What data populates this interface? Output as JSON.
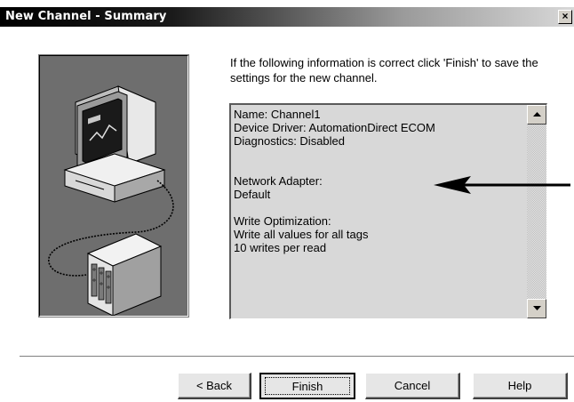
{
  "window": {
    "title": "New Channel - Summary",
    "close_glyph": "×"
  },
  "intro_text": "If the following information is correct click 'Finish' to save the settings for the new channel.",
  "summary": {
    "lines": [
      "Name: Channel1",
      "Device Driver: AutomationDirect ECOM",
      "Diagnostics: Disabled",
      "",
      "",
      "Network Adapter:",
      "Default",
      "",
      "Write Optimization:",
      "Write all values for all tags",
      "10 writes per read"
    ]
  },
  "buttons": {
    "back": "< Back",
    "finish": "Finish",
    "cancel": "Cancel",
    "help": "Help"
  },
  "icons": {
    "illustration": "computer-network-device-illustration",
    "scroll_up": "scroll-up-arrow-icon",
    "scroll_down": "scroll-down-arrow-icon",
    "annotation": "left-arrow-annotation"
  }
}
